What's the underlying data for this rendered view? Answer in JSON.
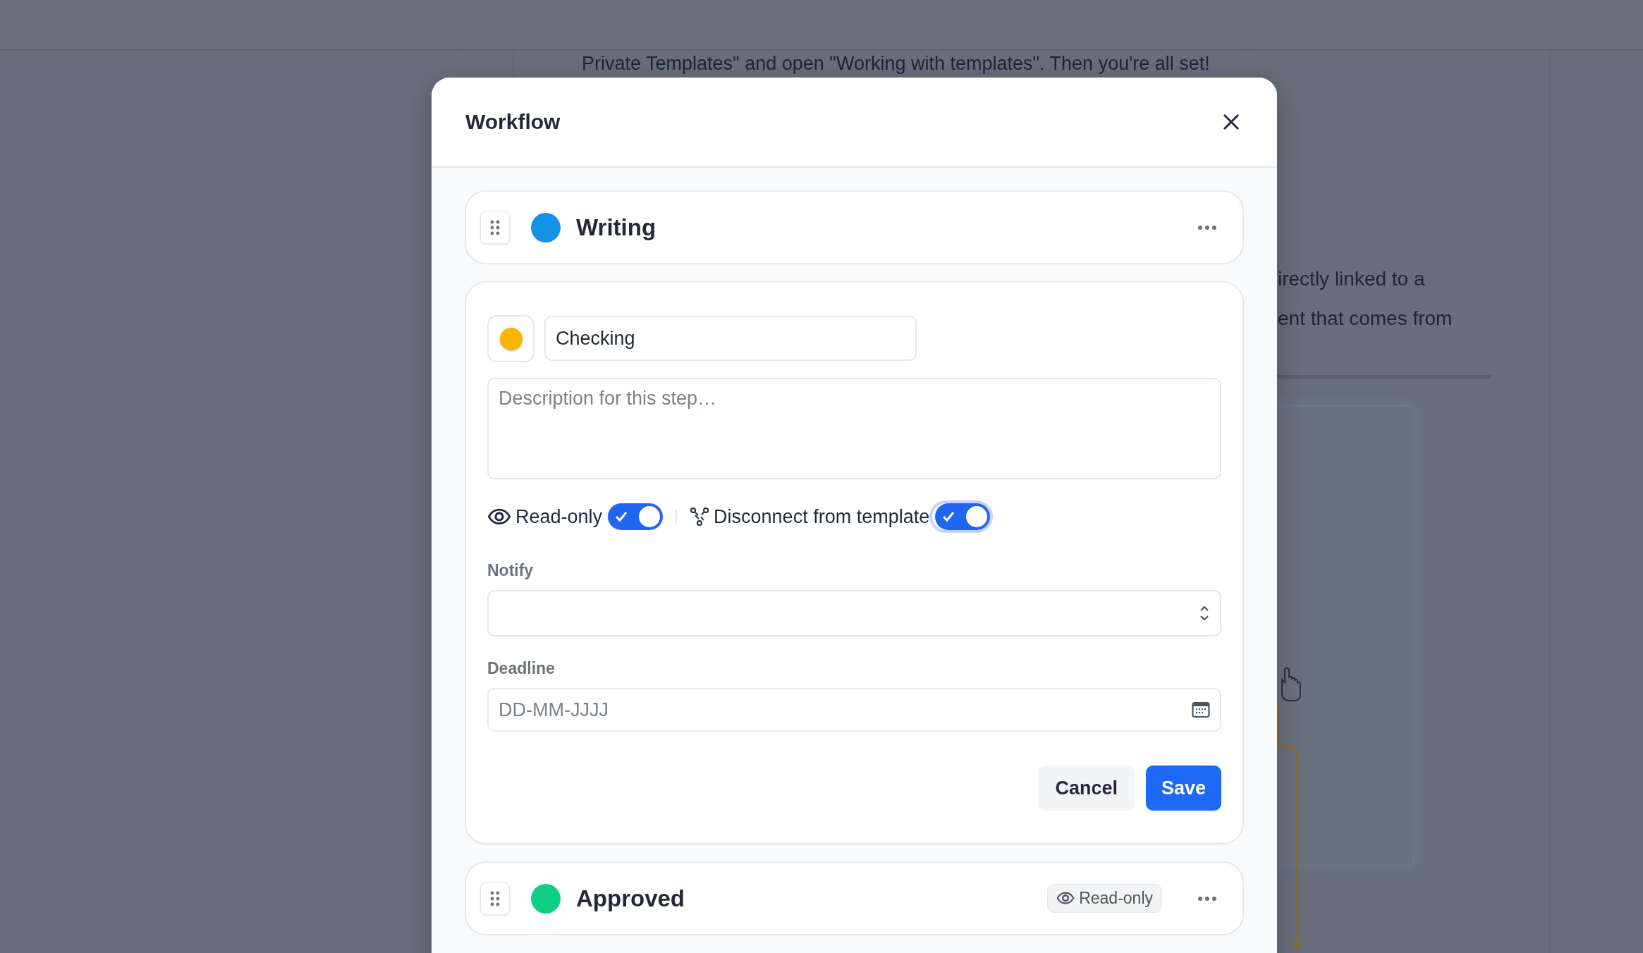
{
  "background": {
    "intro_line": "Private Templates\" and open \"Working with templates\". Then you're all set!",
    "paragraph_lines": [
      "irectly linked to a",
      "ent that comes from"
    ]
  },
  "dialog": {
    "title": "Workflow",
    "steps": [
      {
        "kind": "collapsed",
        "name": "Writing",
        "color": "#1493e6"
      },
      {
        "kind": "editor",
        "name_value": "Checking",
        "color": "#fbb500",
        "description_placeholder": "Description for this step…",
        "toggles": [
          {
            "kind": "eye",
            "label": "Read-only",
            "on": true,
            "focused": false
          },
          {
            "kind": "unlink",
            "label": "Disconnect from template",
            "on": true,
            "focused": true
          }
        ],
        "notify_label": "Notify",
        "deadline_label": "Deadline",
        "deadline_placeholder": "DD-MM-JJJJ",
        "buttons": [
          {
            "kind": "secondary",
            "label": "Cancel"
          },
          {
            "kind": "primary",
            "label": "Save"
          }
        ]
      },
      {
        "kind": "collapsed",
        "name": "Approved",
        "color": "#10cf85",
        "badge": "Read-only"
      }
    ]
  }
}
